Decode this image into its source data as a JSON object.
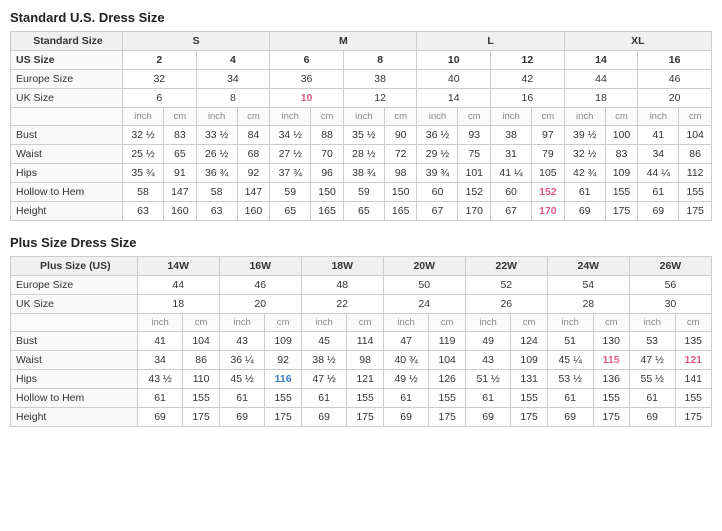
{
  "standard_title": "Standard U.S. Dress Size",
  "plus_title": "Plus Size Dress Size",
  "standard": {
    "size_groups": [
      "S",
      "M",
      "L",
      "XL"
    ],
    "headers": {
      "standard_size": "Standard Size",
      "us_size": "US Size",
      "europe_size": "Europe Size",
      "uk_size": "UK Size"
    },
    "us_sizes": [
      "2",
      "4",
      "6",
      "8",
      "10",
      "12",
      "14",
      "16"
    ],
    "europe_sizes": [
      "32",
      "34",
      "36",
      "38",
      "40",
      "42",
      "44",
      "46"
    ],
    "uk_sizes": [
      "6",
      "8",
      "10",
      "12",
      "14",
      "16",
      "18",
      "20"
    ],
    "unit_row": [
      "inch",
      "cm",
      "inch",
      "cm",
      "inch",
      "cm",
      "inch",
      "cm",
      "inch",
      "cm",
      "inch",
      "cm",
      "inch",
      "cm",
      "inch",
      "cm"
    ],
    "measurements": {
      "bust": [
        "32 ½",
        "83",
        "33 ½",
        "84",
        "34 ½",
        "88",
        "35 ½",
        "90",
        "36 ½",
        "93",
        "38",
        "97",
        "39 ½",
        "100",
        "41",
        "104"
      ],
      "waist": [
        "25 ½",
        "65",
        "26 ½",
        "68",
        "27 ½",
        "70",
        "28 ½",
        "72",
        "29 ½",
        "75",
        "31",
        "79",
        "32 ½",
        "83",
        "34",
        "86"
      ],
      "hips": [
        "35 ¾",
        "91",
        "36 ¾",
        "92",
        "37 ¾",
        "96",
        "38 ¾",
        "98",
        "39 ¾",
        "101",
        "41 ¼",
        "105",
        "42 ¾",
        "109",
        "44 ¼",
        "112"
      ],
      "hollow_to_hem": [
        "58",
        "147",
        "58",
        "147",
        "59",
        "150",
        "59",
        "150",
        "60",
        "152",
        "60",
        "152",
        "61",
        "155",
        "61",
        "155"
      ],
      "height": [
        "63",
        "160",
        "63",
        "160",
        "65",
        "165",
        "65",
        "165",
        "67",
        "170",
        "67",
        "170",
        "69",
        "175",
        "69",
        "175"
      ]
    },
    "highlight_uk": [
      2,
      14
    ],
    "highlight_hollow": [
      10,
      11
    ],
    "highlight_height": [
      10,
      11
    ]
  },
  "plus": {
    "size_groups": [
      "14W",
      "16W",
      "18W",
      "20W",
      "22W",
      "24W",
      "26W"
    ],
    "headers": {
      "plus_size": "Plus Size (US)",
      "europe_size": "Europe Size",
      "uk_size": "UK Size"
    },
    "europe_sizes": [
      "44",
      "46",
      "48",
      "50",
      "52",
      "54",
      "56"
    ],
    "uk_sizes": [
      "18",
      "20",
      "22",
      "24",
      "26",
      "28",
      "30"
    ],
    "unit_row": [
      "inch",
      "cm",
      "inch",
      "cm",
      "inch",
      "cm",
      "inch",
      "cm",
      "inch",
      "cm",
      "inch",
      "cm",
      "inch",
      "cm"
    ],
    "measurements": {
      "bust": [
        "41",
        "104",
        "43",
        "109",
        "45",
        "114",
        "47",
        "119",
        "49",
        "124",
        "51",
        "130",
        "53",
        "135"
      ],
      "waist": [
        "34",
        "86",
        "36 ¼",
        "92",
        "38 ½",
        "98",
        "40 ¾",
        "104",
        "43",
        "109",
        "45 ¼",
        "115",
        "47 ½",
        "121"
      ],
      "hips": [
        "43 ½",
        "110",
        "45 ½",
        "116",
        "47 ½",
        "121",
        "49 ½",
        "126",
        "51 ½",
        "131",
        "53 ½",
        "136",
        "55 ½",
        "141"
      ],
      "hollow_to_hem": [
        "61",
        "155",
        "61",
        "155",
        "61",
        "155",
        "61",
        "155",
        "61",
        "155",
        "61",
        "155",
        "61",
        "155"
      ],
      "height": [
        "69",
        "175",
        "69",
        "175",
        "69",
        "175",
        "69",
        "175",
        "69",
        "175",
        "69",
        "175",
        "69",
        "175"
      ]
    },
    "highlight_waist": [
      7,
      13
    ],
    "highlight_hips": [
      3,
      7
    ],
    "highlight_uk": [
      3,
      7
    ]
  }
}
